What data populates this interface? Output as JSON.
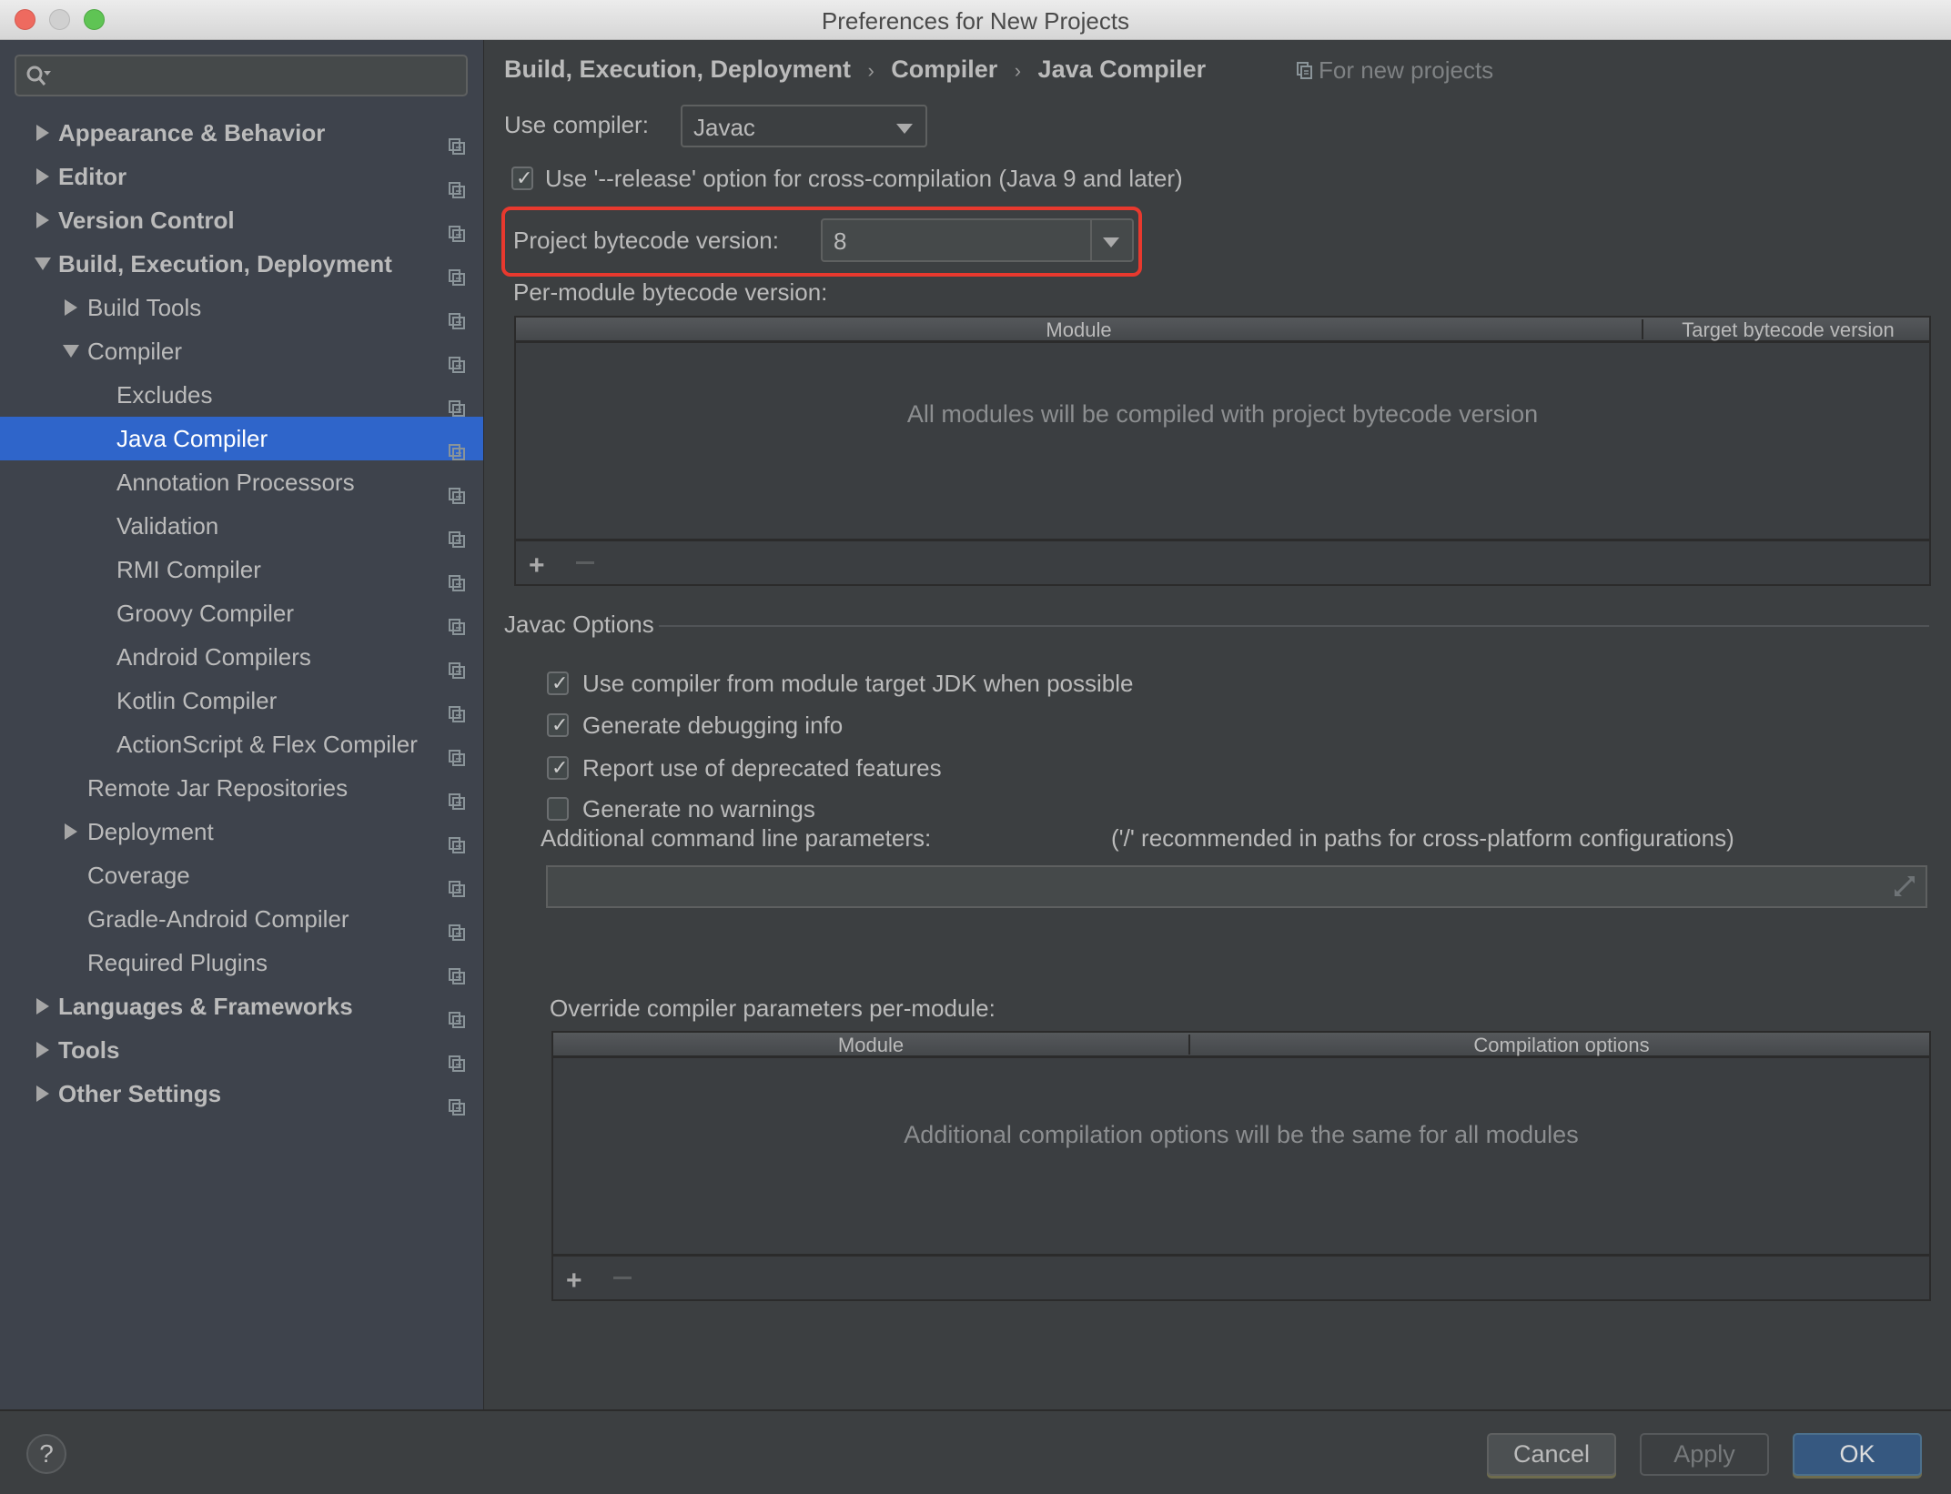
{
  "window": {
    "title": "Preferences for New Projects"
  },
  "sidebar": {
    "search_placeholder": "",
    "items": [
      {
        "label": "Appearance & Behavior",
        "level": 0,
        "bold": true,
        "arrow": "collapsed",
        "selected": false
      },
      {
        "label": "Editor",
        "level": 0,
        "bold": true,
        "arrow": "collapsed",
        "selected": false
      },
      {
        "label": "Version Control",
        "level": 0,
        "bold": true,
        "arrow": "collapsed",
        "selected": false
      },
      {
        "label": "Build, Execution, Deployment",
        "level": 0,
        "bold": true,
        "arrow": "expanded",
        "selected": false
      },
      {
        "label": "Build Tools",
        "level": 1,
        "bold": false,
        "arrow": "collapsed",
        "selected": false
      },
      {
        "label": "Compiler",
        "level": 1,
        "bold": false,
        "arrow": "expanded",
        "selected": false
      },
      {
        "label": "Excludes",
        "level": 2,
        "bold": false,
        "arrow": "none",
        "selected": false
      },
      {
        "label": "Java Compiler",
        "level": 2,
        "bold": false,
        "arrow": "none",
        "selected": true
      },
      {
        "label": "Annotation Processors",
        "level": 2,
        "bold": false,
        "arrow": "none",
        "selected": false
      },
      {
        "label": "Validation",
        "level": 2,
        "bold": false,
        "arrow": "none",
        "selected": false
      },
      {
        "label": "RMI Compiler",
        "level": 2,
        "bold": false,
        "arrow": "none",
        "selected": false
      },
      {
        "label": "Groovy Compiler",
        "level": 2,
        "bold": false,
        "arrow": "none",
        "selected": false
      },
      {
        "label": "Android Compilers",
        "level": 2,
        "bold": false,
        "arrow": "none",
        "selected": false
      },
      {
        "label": "Kotlin Compiler",
        "level": 2,
        "bold": false,
        "arrow": "none",
        "selected": false
      },
      {
        "label": "ActionScript & Flex Compiler",
        "level": 2,
        "bold": false,
        "arrow": "none",
        "selected": false
      },
      {
        "label": "Remote Jar Repositories",
        "level": 1,
        "bold": false,
        "arrow": "none",
        "selected": false
      },
      {
        "label": "Deployment",
        "level": 1,
        "bold": false,
        "arrow": "collapsed",
        "selected": false
      },
      {
        "label": "Coverage",
        "level": 1,
        "bold": false,
        "arrow": "none",
        "selected": false
      },
      {
        "label": "Gradle-Android Compiler",
        "level": 1,
        "bold": false,
        "arrow": "none",
        "selected": false
      },
      {
        "label": "Required Plugins",
        "level": 1,
        "bold": false,
        "arrow": "none",
        "selected": false
      },
      {
        "label": "Languages & Frameworks",
        "level": 0,
        "bold": true,
        "arrow": "collapsed",
        "selected": false
      },
      {
        "label": "Tools",
        "level": 0,
        "bold": true,
        "arrow": "collapsed",
        "selected": false
      },
      {
        "label": "Other Settings",
        "level": 0,
        "bold": true,
        "arrow": "collapsed",
        "selected": false
      }
    ]
  },
  "breadcrumb": {
    "parts": [
      "Build, Execution, Deployment",
      "Compiler",
      "Java Compiler"
    ],
    "separator": "›",
    "scope_label": "For new projects"
  },
  "compiler": {
    "use_compiler_label": "Use compiler:",
    "use_compiler_value": "Javac",
    "release_option_label": "Use '--release' option for cross-compilation (Java 9 and later)",
    "release_option_checked": true,
    "bytecode_label": "Project bytecode version:",
    "bytecode_value": "8",
    "per_module_label": "Per-module bytecode version:",
    "per_module_table": {
      "columns": [
        "Module",
        "Target bytecode version"
      ],
      "rows": [],
      "empty_text": "All modules will be compiled with project bytecode version",
      "add_label": "+",
      "remove_label": "−"
    }
  },
  "javac_options": {
    "group_title": "Javac Options",
    "checkboxes": [
      {
        "label": "Use compiler from module target JDK when possible",
        "checked": true
      },
      {
        "label": "Generate debugging info",
        "checked": true
      },
      {
        "label": "Report use of deprecated features",
        "checked": true
      },
      {
        "label": "Generate no warnings",
        "checked": false
      }
    ],
    "additional_params_label": "Additional command line parameters:",
    "additional_params_hint": "('/' recommended in paths for cross-platform configurations)",
    "additional_params_value": "",
    "override_label": "Override compiler parameters per-module:",
    "override_table": {
      "columns": [
        "Module",
        "Compilation options"
      ],
      "rows": [],
      "empty_text": "Additional compilation options will be the same for all modules",
      "add_label": "+",
      "remove_label": "−"
    }
  },
  "footer": {
    "help_label": "?",
    "cancel_label": "Cancel",
    "apply_label": "Apply",
    "ok_label": "OK"
  },
  "colors": {
    "selection": "#2f65ca",
    "highlight_border": "#e8392e",
    "ok_button": "#365880"
  }
}
